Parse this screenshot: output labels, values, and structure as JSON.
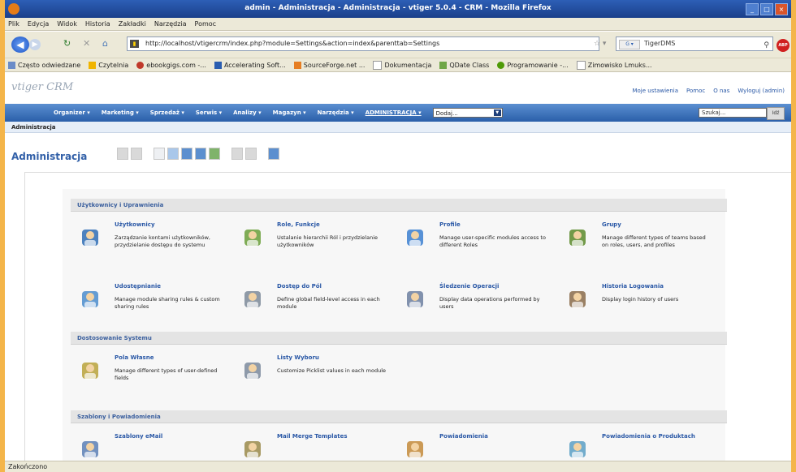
{
  "window": {
    "title": "admin - Administracja - Administracja - vtiger 5.0.4 - CRM - Mozilla Firefox"
  },
  "menubar": {
    "items": [
      "Plik",
      "Edycja",
      "Widok",
      "Historia",
      "Zakładki",
      "Narzędzia",
      "Pomoc"
    ]
  },
  "navigation": {
    "url": "http://localhost/vtigercrm/index.php?module=Settings&action=index&parenttab=Settings",
    "search_value": "TigerDMS"
  },
  "bookmarks": {
    "items": [
      {
        "label": "Często odwiedzane",
        "color": "#6a8cc8"
      },
      {
        "label": "Czytelnia",
        "color": "#f0b400"
      },
      {
        "label": "ebookgigs.com -...",
        "color": "#c0392b"
      },
      {
        "label": "Accelerating Soft...",
        "color": "#2a5db0"
      },
      {
        "label": "SourceForge.net ...",
        "color": "#e67e22"
      },
      {
        "label": "Dokumentacja",
        "color": "#cccccc"
      },
      {
        "label": "QDate Class",
        "color": "#6fa646"
      },
      {
        "label": "Programowanie -...",
        "color": "#4e9a06"
      },
      {
        "label": "Zimowisko Lmuks...",
        "color": "#cccccc"
      }
    ]
  },
  "vtiger": {
    "logo": "vtiger CRM",
    "toplinks": [
      "Moje ustawienia",
      "Pomoc",
      "O nas",
      "Wyloguj (admin)"
    ],
    "tabs": [
      "Organizer ▾",
      "Marketing ▾",
      "Sprzedaż ▾",
      "Serwis ▾",
      "Analizy ▾",
      "Magazyn ▾",
      "Narzędzia ▾",
      "ADMINISTRACJA ▾"
    ],
    "quickadd": "Dodaj...",
    "search_value": "Szukaj...",
    "search_btn": "Idź",
    "breadcrumb": "Administracja",
    "module_title": "Administracja"
  },
  "sections": [
    {
      "title": "Użytkownicy i Uprawnienia",
      "items": [
        {
          "label": "Użytkownicy",
          "desc": "Zarządzanie kontami użytkowników, przydzielanie dostępu do systemu",
          "icon": "users-icon"
        },
        {
          "label": "Role, Funkcje",
          "desc": "Ustalanie hierarchii Ról i przydzielanie użytkowników",
          "icon": "roles-icon"
        },
        {
          "label": "Profile",
          "desc": "Manage user-specific modules access to different Roles",
          "icon": "profiles-icon"
        },
        {
          "label": "Grupy",
          "desc": "Manage different types of teams based on roles, users, and profiles",
          "icon": "groups-icon"
        },
        {
          "label": "Udostępnianie",
          "desc": "Manage module sharing rules & custom sharing rules",
          "icon": "sharing-icon"
        },
        {
          "label": "Dostęp do Pól",
          "desc": "Define global field-level access in each module",
          "icon": "field-access-icon"
        },
        {
          "label": "Śledzenie Operacji",
          "desc": "Display data operations performed by users",
          "icon": "audit-trail-icon"
        },
        {
          "label": "Historia Logowania",
          "desc": "Display login history of users",
          "icon": "login-history-icon"
        }
      ]
    },
    {
      "title": "Dostosowanie Systemu",
      "items": [
        {
          "label": "Pola Własne",
          "desc": "Manage different types of user-defined fields",
          "icon": "custom-fields-icon"
        },
        {
          "label": "Listy Wyboru",
          "desc": "Customize Picklist values in each module",
          "icon": "picklist-icon"
        }
      ]
    },
    {
      "title": "Szablony i Powiadomienia",
      "items": [
        {
          "label": "Szablony eMail",
          "desc": "",
          "icon": "email-templates-icon"
        },
        {
          "label": "Mail Merge Templates",
          "desc": "",
          "icon": "mail-merge-icon"
        },
        {
          "label": "Powiadomienia",
          "desc": "",
          "icon": "notifications-icon"
        },
        {
          "label": "Powiadomienia o Produktach",
          "desc": "",
          "icon": "product-notifications-icon"
        }
      ]
    }
  ],
  "statusbar": {
    "text": "Zakończono"
  }
}
